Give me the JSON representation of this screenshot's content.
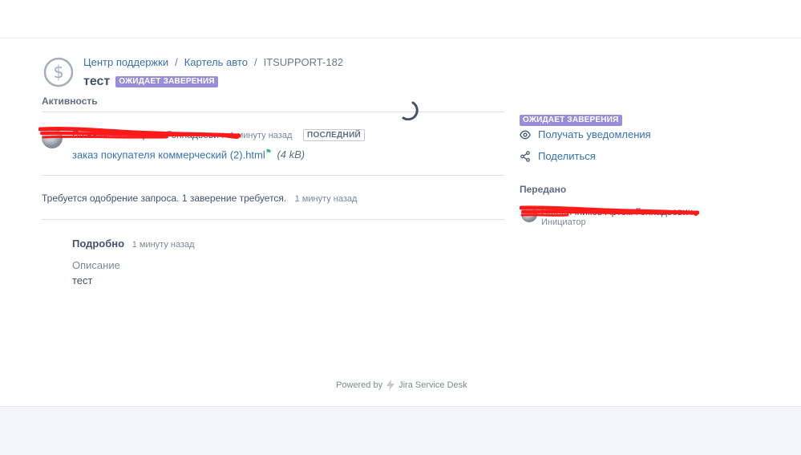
{
  "breadcrumb": {
    "items": [
      "Центр поддержки",
      "Картель авто"
    ],
    "separator": "/",
    "current": "ITSUPPORT-182"
  },
  "request": {
    "title": "тест",
    "status": "ОЖИДАЕТ ЗАВЕРЕНИЯ"
  },
  "activity": {
    "heading": "Активность",
    "comment": {
      "author": "Пшеничников Артем Геннадьевич",
      "time": "1 минуту назад",
      "tag": "ПОСЛЕДНИЙ",
      "attachment_name": "заказ покупателя коммерческий (2).html",
      "attachment_size": "(4 kB)"
    },
    "approval": {
      "text": "Требуется одобрение запроса. 1 заверение требуется.",
      "time": "1 минуту назад"
    },
    "details": {
      "label": "Подробно",
      "time": "1 минуту назад",
      "description_label": "Описание",
      "description_value": "тест"
    }
  },
  "sidebar": {
    "status": "ОЖИДАЕТ ЗАВЕРЕНИЯ",
    "notify_label": "Получать уведомления",
    "share_label": "Поделиться",
    "shared_heading": "Передано",
    "shared_name": "Пшеничников Артем Геннадьевич",
    "shared_role": "Инициатор"
  },
  "footer": {
    "powered_by": "Powered by",
    "product": "Jira Service Desk"
  },
  "colors": {
    "link": "#3572b0",
    "status_badge": "#998dd9",
    "redaction": "#ff1a1a",
    "spinner": "#42526e"
  }
}
